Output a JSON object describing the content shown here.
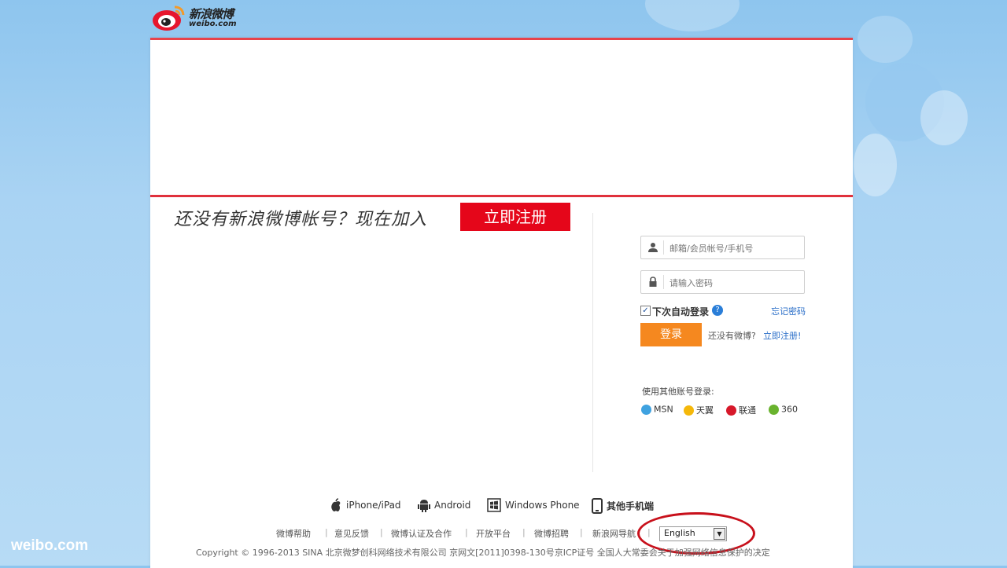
{
  "logo": {
    "cn": "新浪微博",
    "en": "weibo.com"
  },
  "watermark": "weibo.com",
  "promo": {
    "text": "还没有新浪微博帐号？现在加入",
    "register_label": "立即注册"
  },
  "login": {
    "username_placeholder": "邮箱/会员帐号/手机号",
    "password_placeholder": "请输入密码",
    "remember_label": "下次自动登录",
    "remember_checked": true,
    "help": "?",
    "forgot_label": "忘记密码",
    "login_label": "登录",
    "no_account_text": "还没有微博?",
    "register_link": "立即注册!"
  },
  "other_login": {
    "title": "使用其他账号登录:",
    "partners": [
      {
        "name": "MSN",
        "color": "#3fa2e0"
      },
      {
        "name": "天翼",
        "color": "#f5b80a"
      },
      {
        "name": "联通",
        "color": "#d7182a"
      },
      {
        "name": "360",
        "color": "#69b32e"
      }
    ]
  },
  "platforms": [
    {
      "label": "iPhone/iPad",
      "icon": "apple-icon"
    },
    {
      "label": "Android",
      "icon": "android-icon"
    },
    {
      "label": "Windows Phone",
      "icon": "windows-icon"
    },
    {
      "label": "其他手机端",
      "icon": "phone-icon"
    }
  ],
  "footer": {
    "links": [
      "微博帮助",
      "意见反馈",
      "微博认证及合作",
      "开放平台",
      "微博招聘",
      "新浪网导航"
    ],
    "language": "English",
    "copyright": "Copyright © 1996-2013 SINA 北京微梦创科网络技术有限公司   京网文[2011]0398-130号京ICP证号   全国人大常委会关于加强网络信息保护的决定"
  },
  "colors": {
    "brand_red": "#e5061a",
    "login_orange": "#f5881f",
    "link_blue": "#2a6ec8",
    "annotation_red": "#c8101b"
  }
}
